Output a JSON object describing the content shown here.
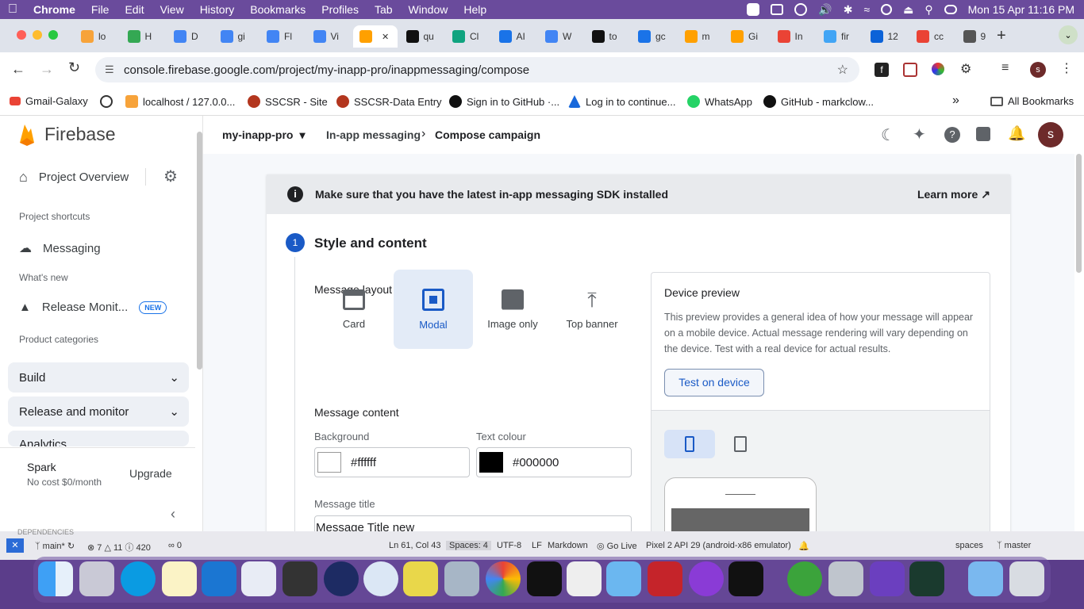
{
  "menubar": {
    "app": "Chrome",
    "items": [
      "File",
      "Edit",
      "View",
      "History",
      "Bookmarks",
      "Profiles",
      "Tab",
      "Window",
      "Help"
    ],
    "datetime": "Mon 15 Apr  11:16 PM"
  },
  "tabs": [
    "lo",
    "H",
    "D",
    "gi",
    "Fl",
    "Vi",
    "",
    "qu",
    "Cl",
    "AI",
    "W",
    "to",
    "gc",
    "m",
    "Gi",
    "In",
    "fir",
    "12",
    "cc",
    "9"
  ],
  "address": {
    "url": "console.firebase.google.com/project/my-inapp-pro/inappmessaging/compose"
  },
  "bookmarks": {
    "items": [
      "Gmail-Galaxy",
      "localhost / 127.0.0...",
      "SSCSR - Site",
      "SSCSR-Data Entry",
      "Sign in to GitHub ·...",
      "Log in to continue...",
      "WhatsApp",
      "GitHub - markclow..."
    ],
    "all": "All Bookmarks",
    "avatar": "s"
  },
  "sidebar": {
    "brand": "Firebase",
    "project_overview": "Project Overview",
    "shortcuts_caption": "Project shortcuts",
    "messaging": "Messaging",
    "whats_new": "What's new",
    "release": "Release Monit...",
    "new_badge": "NEW",
    "categories_caption": "Product categories",
    "sections": [
      "Build",
      "Release and monitor",
      "Analytics"
    ],
    "plan_name": "Spark",
    "plan_desc": "No cost $0/month",
    "upgrade": "Upgrade"
  },
  "topbar": {
    "project": "my-inapp-pro",
    "crumb1": "In-app messaging",
    "crumb2": "Compose campaign",
    "avatar": "s"
  },
  "banner": {
    "text": "Make sure that you have the latest in-app messaging SDK installed",
    "learn_more": "Learn more"
  },
  "step": {
    "number": "1",
    "title": "Style and content"
  },
  "layout": {
    "label": "Message layout",
    "options": [
      "Card",
      "Modal",
      "Image only",
      "Top banner"
    ],
    "selected": "Modal"
  },
  "content": {
    "label": "Message content",
    "bg_label": "Background",
    "bg_value": "#ffffff",
    "text_label": "Text colour",
    "text_value": "#000000",
    "title_label": "Message title",
    "title_value": "Message Title new"
  },
  "preview": {
    "title": "Device preview",
    "desc": "This preview provides a general idea of how your message will appear on a mobile device. Actual message rendering will vary depending on the device. Test with a real device for actual results.",
    "test_button": "Test on device"
  },
  "statusbar": {
    "branch": "main*",
    "errors": "7",
    "warnings": "11",
    "info": "420",
    "ports": "0",
    "position": "Ln 61, Col 43",
    "spaces": "Spaces: 4",
    "encoding": "UTF-8",
    "eol": "LF",
    "lang": "Markdown",
    "golive": "Go Live",
    "device": "Pixel 2 API 29 (android-x86 emulator)",
    "spaces2": "spaces",
    "branch2": "master",
    "deps": "DEPENDENCIES"
  },
  "colors": {
    "accent": "#1a73e8",
    "firebase": "#ffa000"
  }
}
